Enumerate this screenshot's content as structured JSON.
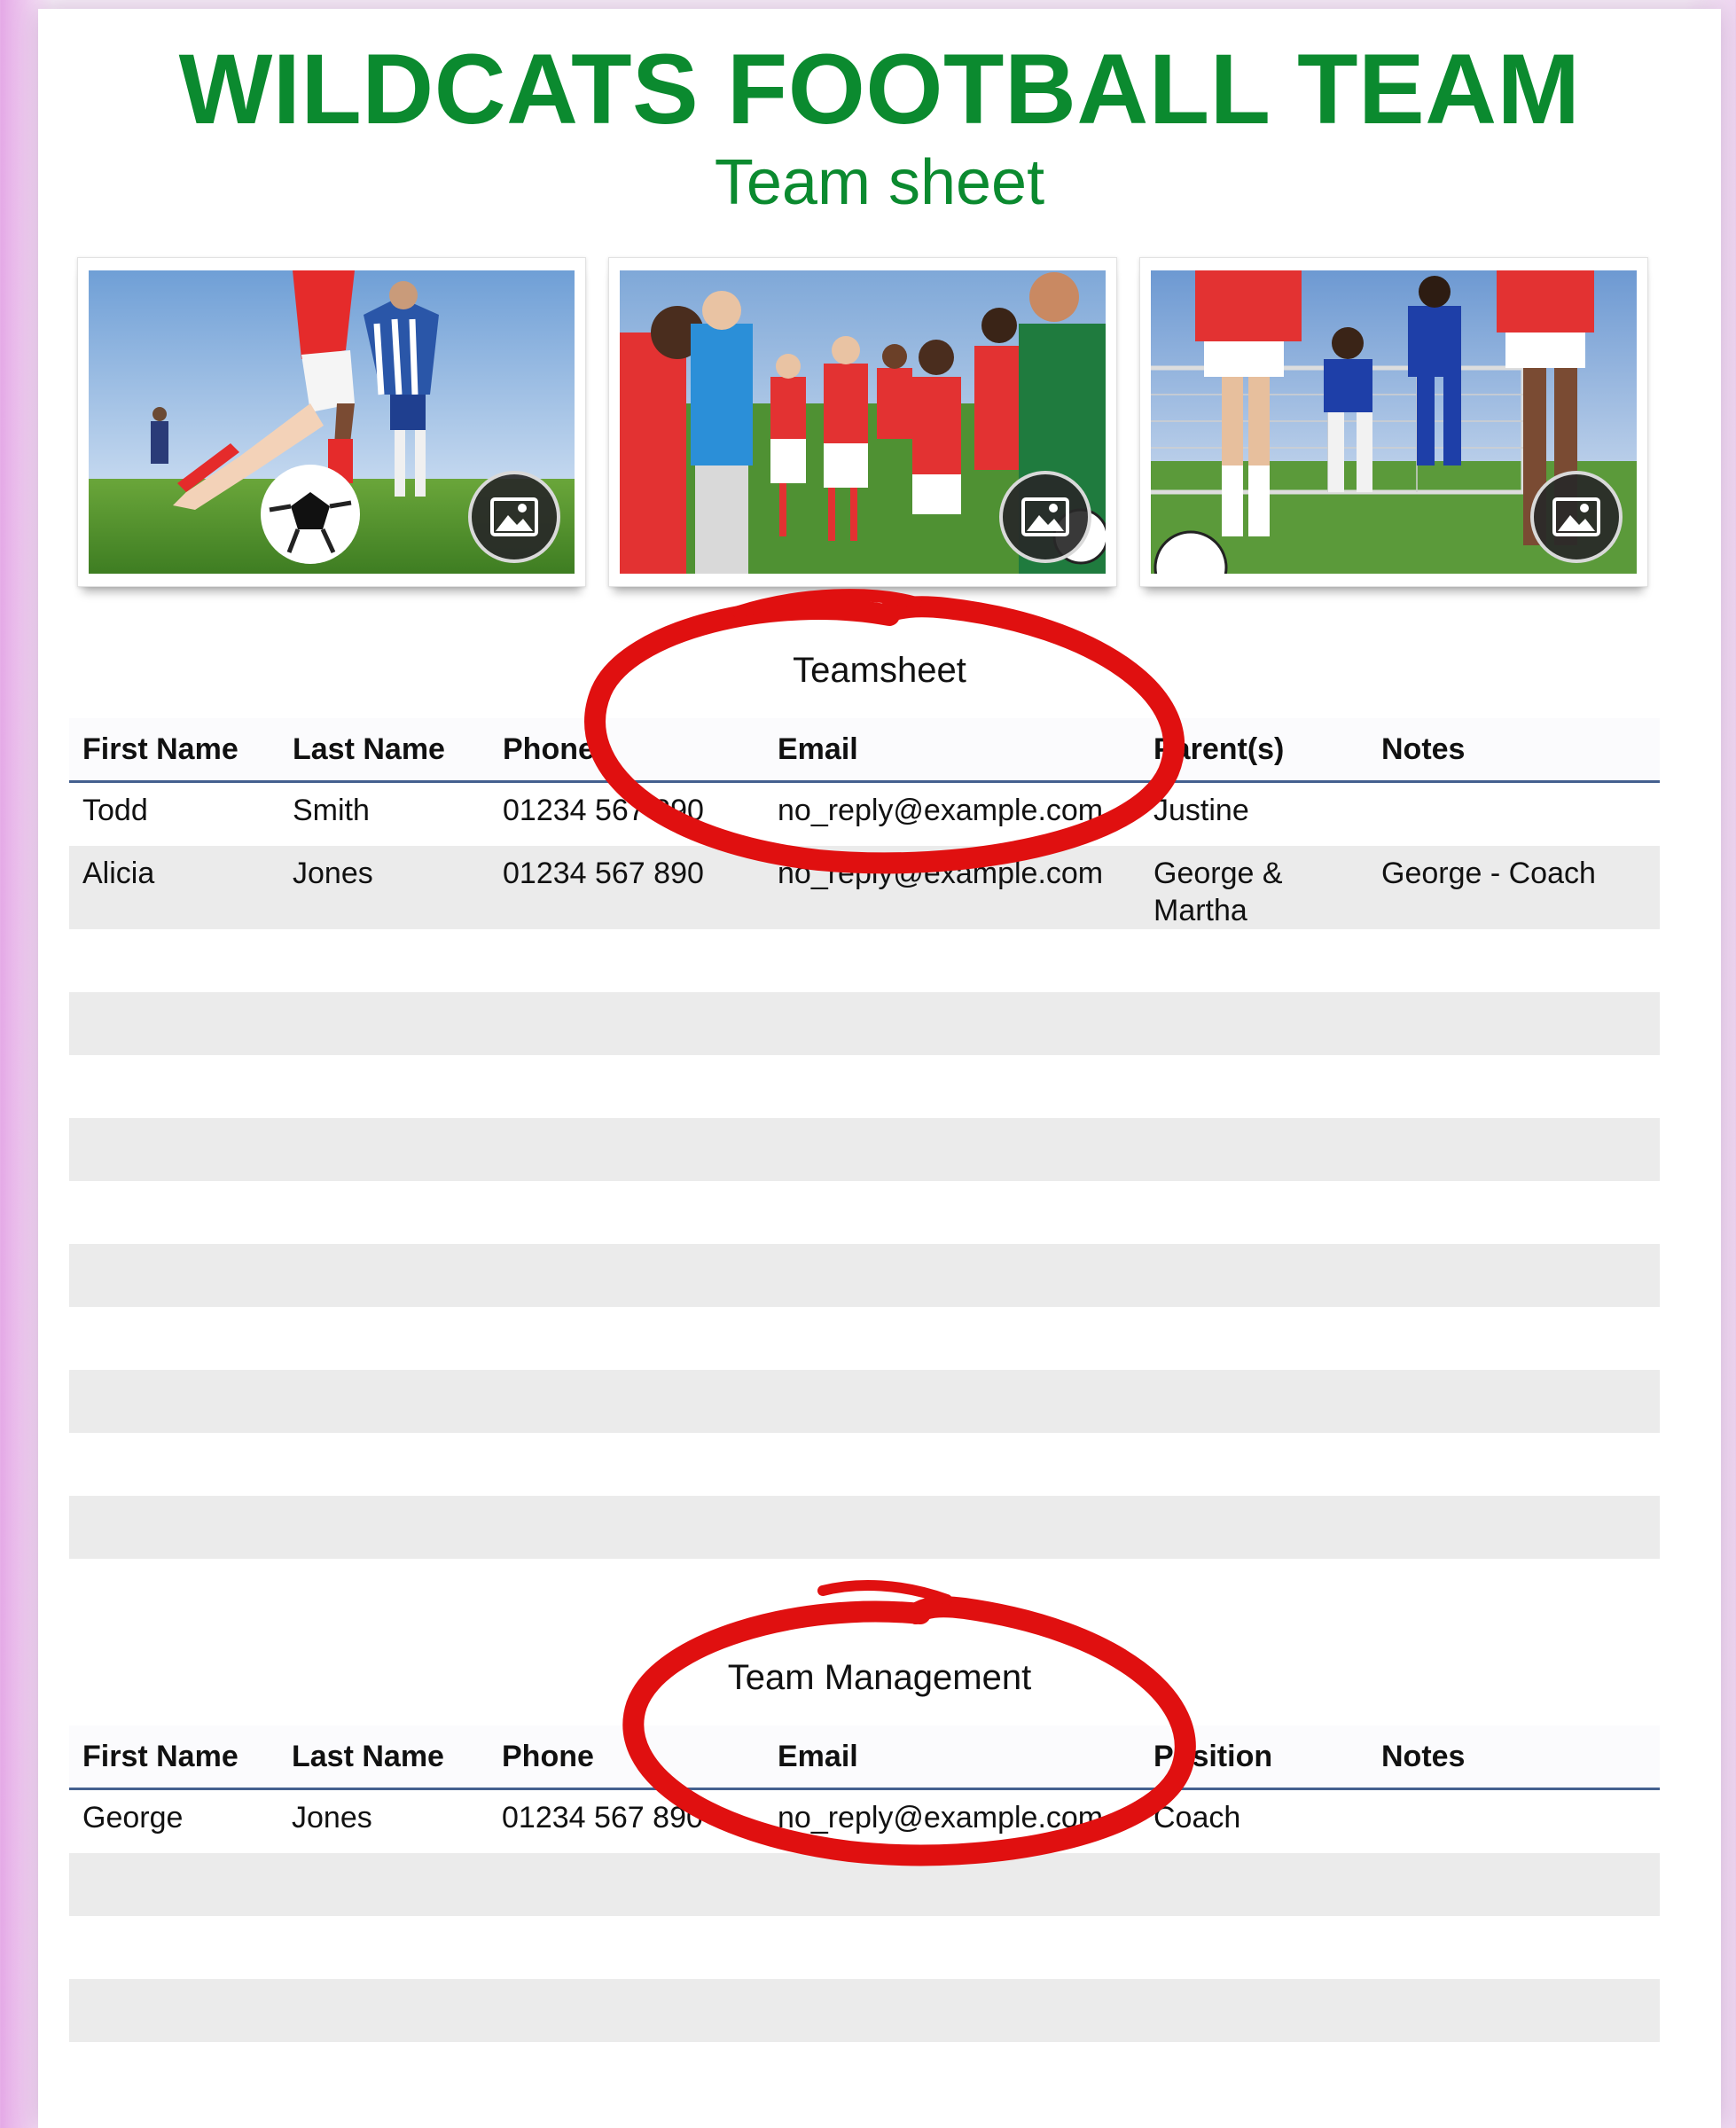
{
  "header": {
    "title": "WILDCATS FOOTBALL TEAM",
    "subtitle": "Team sheet"
  },
  "photos": [
    {
      "icon": "image-icon",
      "subject": "soccer-player-kicking-ball"
    },
    {
      "icon": "image-icon",
      "subject": "team-with-coach"
    },
    {
      "icon": "image-icon",
      "subject": "kids-playing-soccer"
    }
  ],
  "teamsheet": {
    "title": "Teamsheet",
    "columns": [
      "First Name",
      "Last Name",
      "Phone",
      "Email",
      "Parent(s)",
      "Notes"
    ],
    "rows": [
      [
        "Todd",
        "Smith",
        "01234 567 890",
        "no_reply@example.com",
        "Justine",
        ""
      ],
      [
        "Alicia",
        "Jones",
        "01234 567 890",
        "no_reply@example.com",
        "George & Martha",
        "George - Coach"
      ],
      [
        "",
        "",
        "",
        "",
        "",
        ""
      ],
      [
        "",
        "",
        "",
        "",
        "",
        ""
      ],
      [
        "",
        "",
        "",
        "",
        "",
        ""
      ],
      [
        "",
        "",
        "",
        "",
        "",
        ""
      ],
      [
        "",
        "",
        "",
        "",
        "",
        ""
      ],
      [
        "",
        "",
        "",
        "",
        "",
        ""
      ],
      [
        "",
        "",
        "",
        "",
        "",
        ""
      ],
      [
        "",
        "",
        "",
        "",
        "",
        ""
      ],
      [
        "",
        "",
        "",
        "",
        "",
        ""
      ],
      [
        "",
        "",
        "",
        "",
        "",
        ""
      ]
    ]
  },
  "management": {
    "title": "Team Management",
    "columns": [
      "First Name",
      "Last Name",
      "Phone",
      "Email",
      "Position",
      "Notes"
    ],
    "rows": [
      [
        "George",
        "Jones",
        "01234 567 890",
        "no_reply@example.com",
        "Coach",
        ""
      ],
      [
        "",
        "",
        "",
        "",
        "",
        ""
      ],
      [
        "",
        "",
        "",
        "",
        "",
        ""
      ],
      [
        "",
        "",
        "",
        "",
        "",
        ""
      ],
      [
        "",
        "",
        "",
        "",
        "",
        ""
      ]
    ]
  },
  "colors": {
    "title_green": "#0b8a2f",
    "header_rule": "#44608f",
    "stripe": "#ebebeb",
    "annotation_red": "#e01010"
  }
}
